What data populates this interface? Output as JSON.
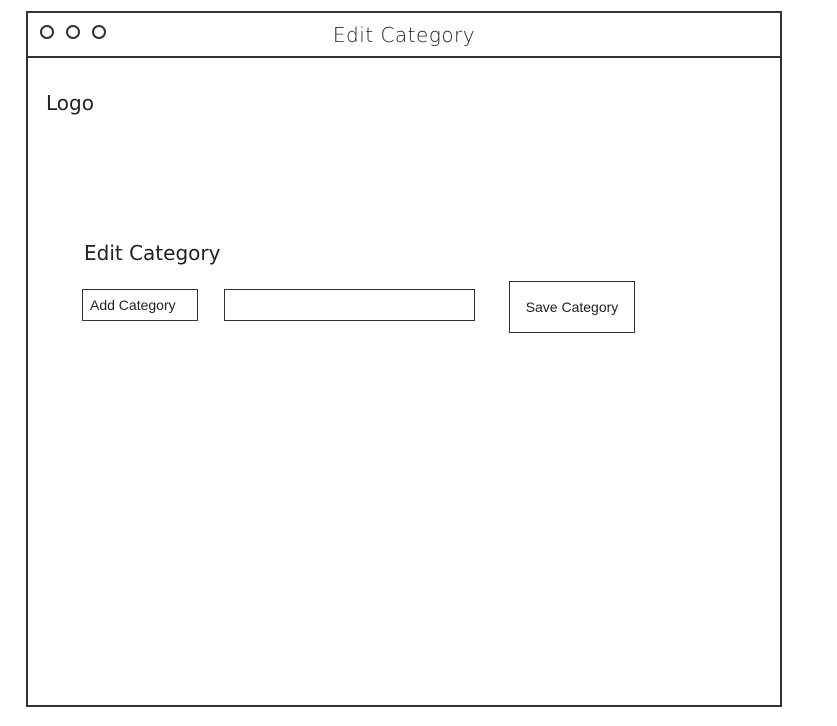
{
  "window": {
    "title": "Edit Category"
  },
  "header": {
    "logo": "Logo"
  },
  "form": {
    "section_title": "Edit Category",
    "add_category_label": "Add Category",
    "category_value": "",
    "save_label": "Save Category"
  },
  "colors": {
    "border": "#333333",
    "background": "#ffffff",
    "text": "#222222"
  }
}
